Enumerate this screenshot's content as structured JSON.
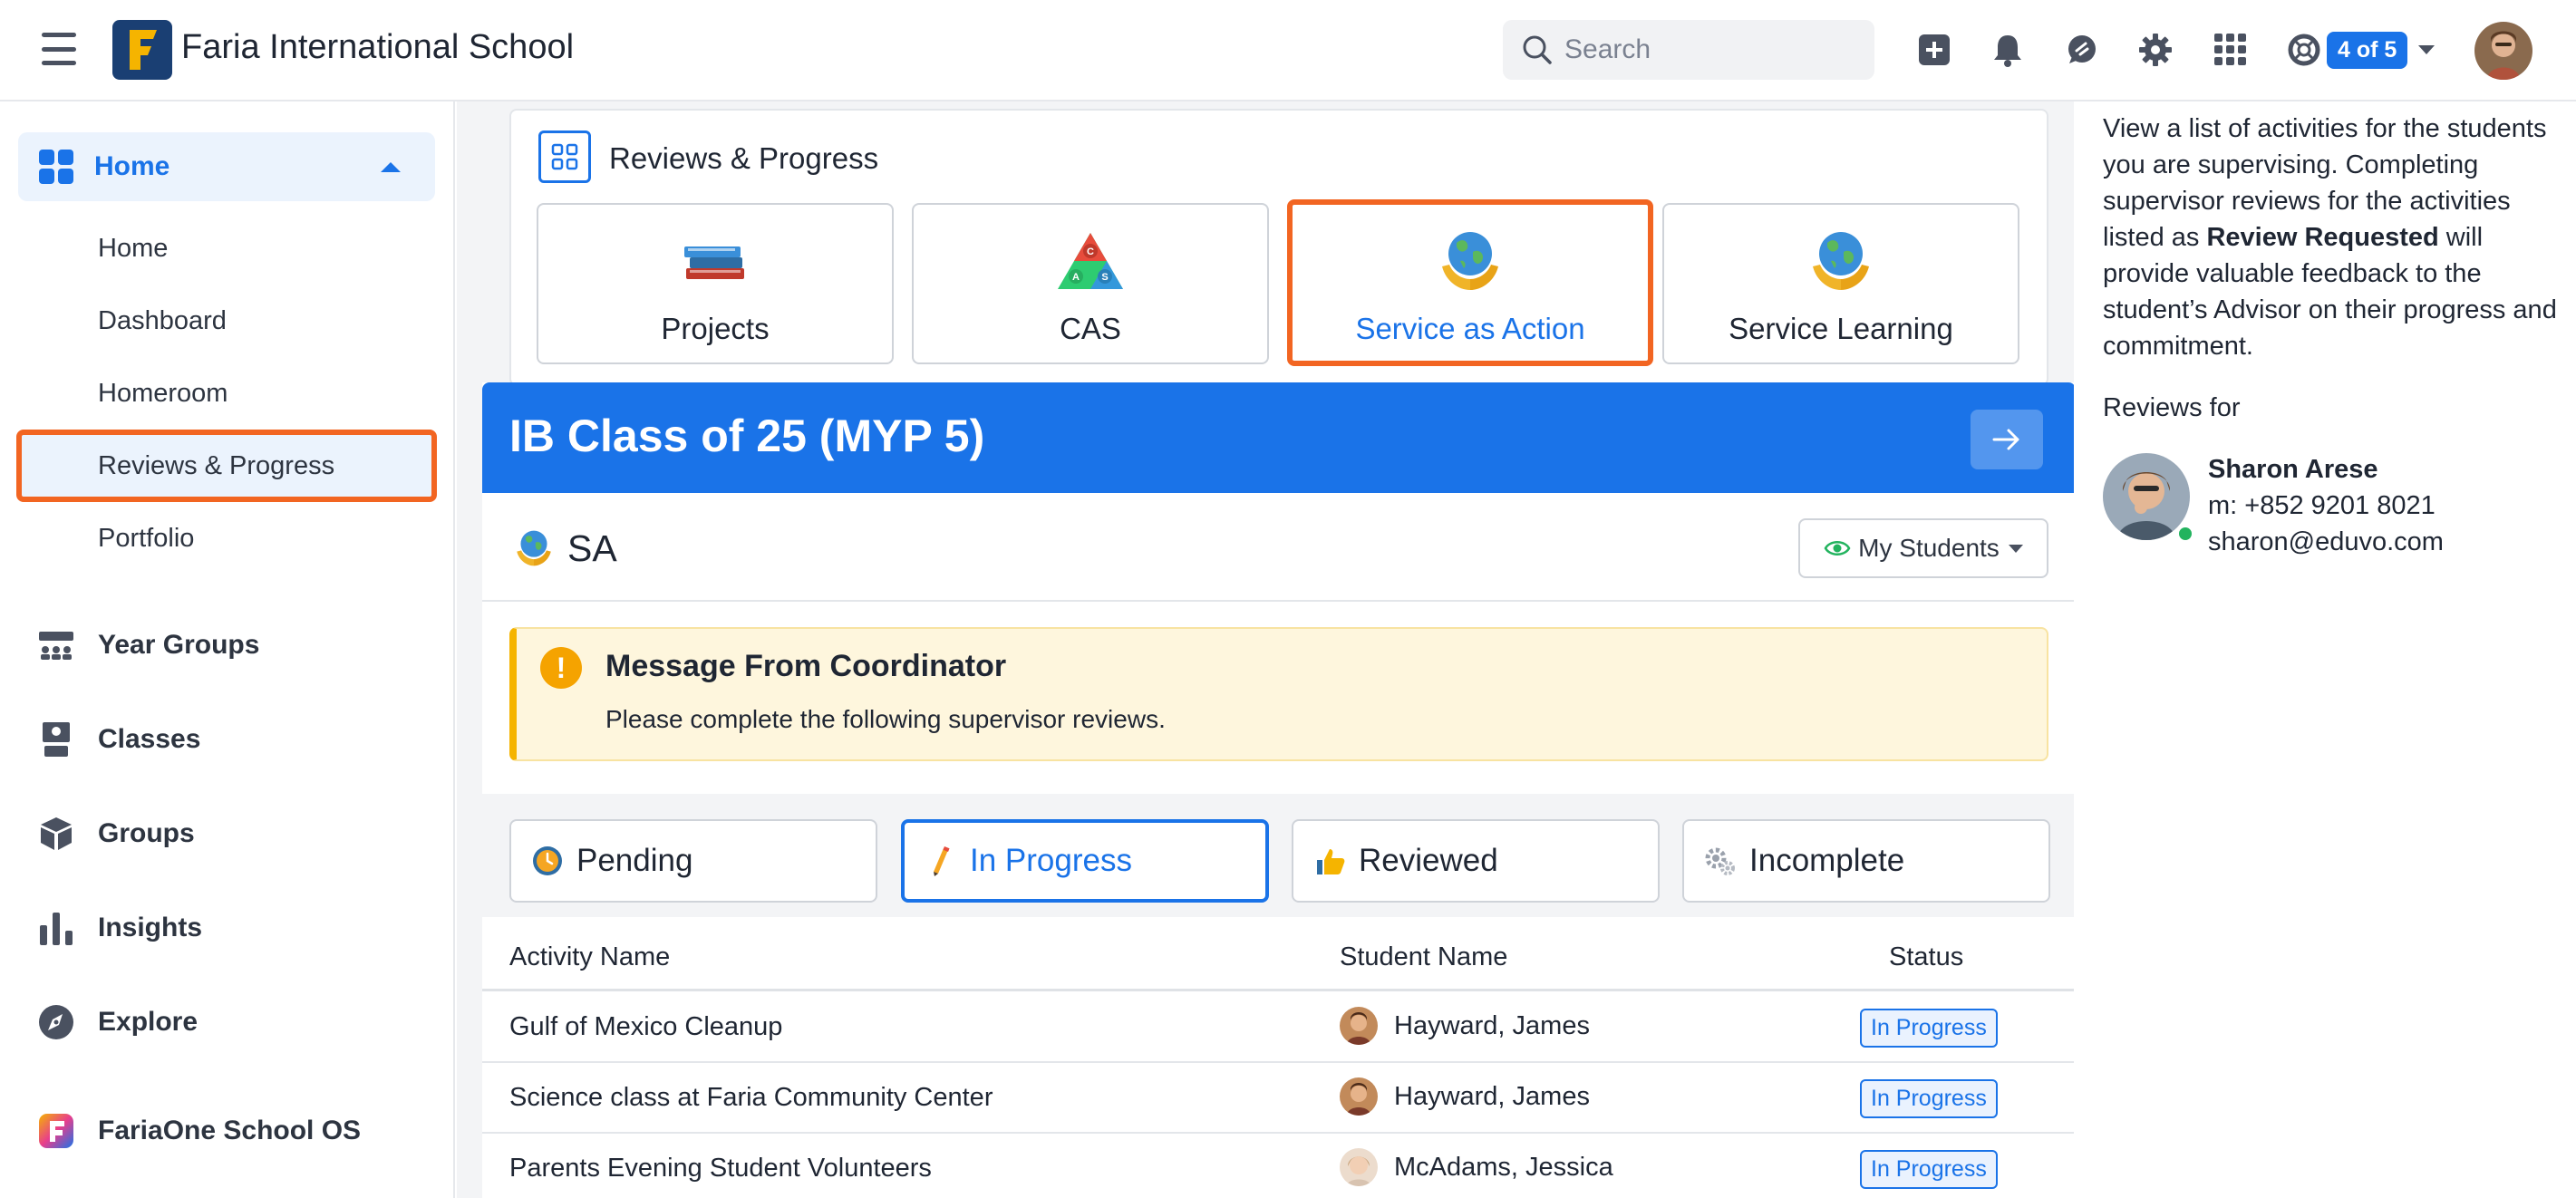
{
  "header": {
    "school_name": "Faria International School",
    "search_placeholder": "Search",
    "badge": "4 of 5"
  },
  "sidebar": {
    "home_label": "Home",
    "sub_items": [
      "Home",
      "Dashboard",
      "Homeroom",
      "Reviews & Progress",
      "Portfolio"
    ],
    "main_items": [
      "Year Groups",
      "Classes",
      "Groups",
      "Insights",
      "Explore",
      "FariaOne School OS"
    ]
  },
  "reviews_progress": {
    "title": "Reviews & Progress",
    "programs": [
      "Projects",
      "CAS",
      "Service as Action",
      "Service Learning"
    ],
    "active_program": "Service as Action"
  },
  "class_card": {
    "title": "IB Class of 25 (MYP 5)",
    "section_label": "SA",
    "filter_dropdown": "My Students"
  },
  "message": {
    "title": "Message From Coordinator",
    "text": "Please complete the following supervisor reviews."
  },
  "filters": [
    "Pending",
    "In Progress",
    "Reviewed",
    "Incomplete"
  ],
  "active_filter": "In Progress",
  "table": {
    "columns": [
      "Activity Name",
      "Student Name",
      "Status"
    ],
    "rows": [
      {
        "activity": "Gulf of Mexico Cleanup",
        "student": "Hayward, James",
        "status": "In Progress"
      },
      {
        "activity": "Science class at Faria Community Center",
        "student": "Hayward, James",
        "status": "In Progress"
      },
      {
        "activity": "Parents Evening Student Volunteers",
        "student": "McAdams, Jessica",
        "status": "In Progress"
      }
    ]
  },
  "right_panel": {
    "help_part1": "View a list of activities for the students you are supervising. Completing supervisor reviews for the activities listed as ",
    "help_bold": "Review Requested",
    "help_part2": " will provide valuable feedback to the student’s Advisor on their progress and commitment.",
    "reviews_for": "Reviews for",
    "supervisor_name": "Sharon Arese",
    "supervisor_phone": "m: +852 9201 8021",
    "supervisor_email": "sharon@eduvo.com"
  },
  "colors": {
    "accent": "#1a73e8",
    "highlight": "#f26522",
    "warning": "#f5b400"
  }
}
